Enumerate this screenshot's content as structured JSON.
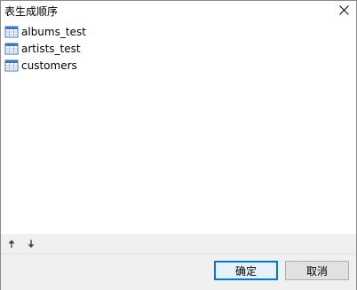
{
  "window": {
    "title": "表生成顺序"
  },
  "list": {
    "items": [
      {
        "label": "albums_test",
        "icon": "table-icon"
      },
      {
        "label": "artists_test",
        "icon": "table-icon"
      },
      {
        "label": "customers",
        "icon": "table-icon"
      }
    ]
  },
  "toolbar": {
    "move_up_icon": "arrow-up-icon",
    "move_down_icon": "arrow-down-icon"
  },
  "footer": {
    "ok_label": "确定",
    "cancel_label": "取消"
  },
  "colors": {
    "accent": "#0078d7",
    "footer_bg": "#f0f0f0"
  }
}
